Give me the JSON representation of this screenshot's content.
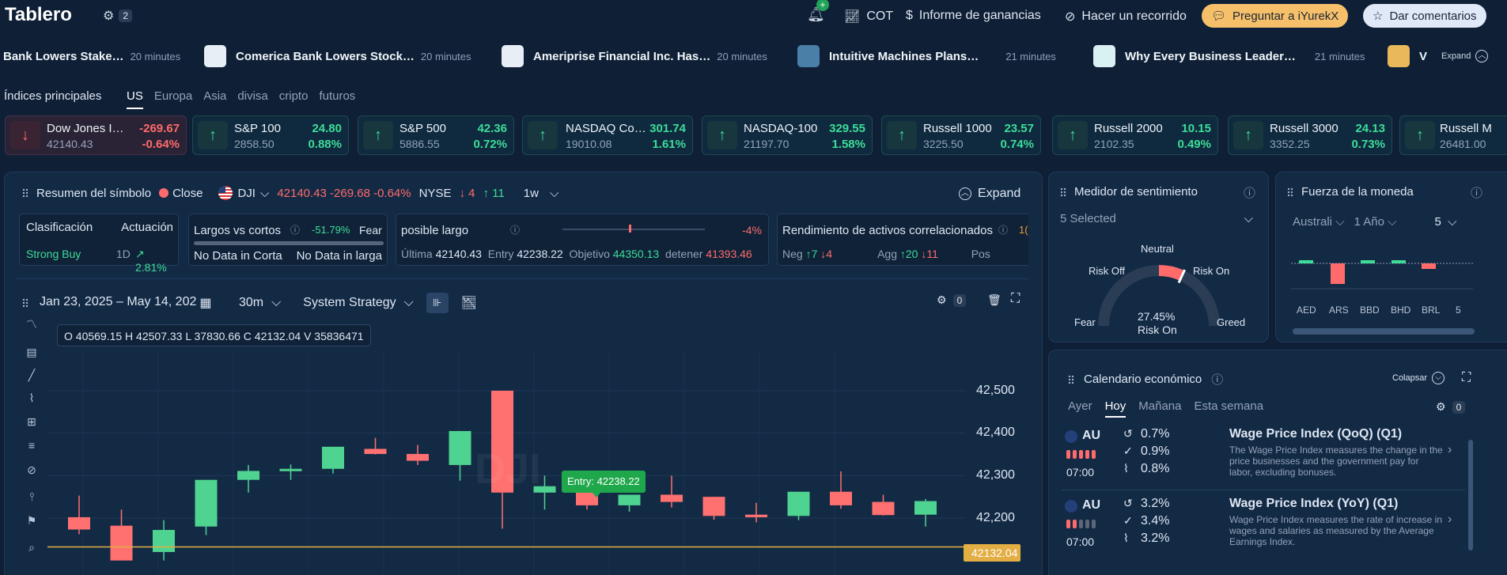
{
  "header": {
    "title": "Tablero",
    "filter_count": "2",
    "nav": [
      {
        "label": "COT",
        "icon": "chart-line-icon"
      },
      {
        "label": "Informe de ganancias",
        "icon": "dollar-icon"
      },
      {
        "label": "Hacer un recorrido",
        "icon": "compass-icon"
      }
    ],
    "ask_label": "Preguntar a iYurekX",
    "feedback_label": "Dar comentarios",
    "notification_badge": "+"
  },
  "news_ticker": {
    "items": [
      {
        "title": "Bank Lowers Stake…",
        "time": "20 minutes"
      },
      {
        "title": "Comerica Bank Lowers Stock…",
        "time": "20 minutes"
      },
      {
        "title": "Ameriprise Financial Inc. Has…",
        "time": "20 minutes"
      },
      {
        "title": "Intuitive Machines Plans…",
        "time": "21 minutes"
      },
      {
        "title": "Why Every Business Leader…",
        "time": "21 minutes"
      },
      {
        "title": "V",
        "time": ""
      }
    ],
    "expand_label": "Expand"
  },
  "indices": {
    "label": "Índices principales",
    "tabs": [
      "US",
      "Europa",
      "Asia",
      "divisa",
      "cripto",
      "futuros"
    ],
    "active_tab": "US",
    "cards": [
      {
        "name": "Dow Jones I…",
        "price": "42140.43",
        "change": "-269.67",
        "pct": "-0.64%",
        "dir": "down"
      },
      {
        "name": "S&P 100",
        "price": "2858.50",
        "change": "24.80",
        "pct": "0.88%",
        "dir": "up"
      },
      {
        "name": "S&P 500",
        "price": "5886.55",
        "change": "42.36",
        "pct": "0.72%",
        "dir": "up"
      },
      {
        "name": "NASDAQ Co…",
        "price": "19010.08",
        "change": "301.74",
        "pct": "1.61%",
        "dir": "up"
      },
      {
        "name": "NASDAQ-100",
        "price": "21197.70",
        "change": "329.55",
        "pct": "1.58%",
        "dir": "up"
      },
      {
        "name": "Russell 1000",
        "price": "3225.50",
        "change": "23.57",
        "pct": "0.74%",
        "dir": "up"
      },
      {
        "name": "Russell 2000",
        "price": "2102.35",
        "change": "10.15",
        "pct": "0.49%",
        "dir": "up"
      },
      {
        "name": "Russell 3000",
        "price": "3352.25",
        "change": "24.13",
        "pct": "0.73%",
        "dir": "up"
      },
      {
        "name": "Russell M",
        "price": "26481.00",
        "change": "",
        "pct": "",
        "dir": "up"
      }
    ]
  },
  "symbol": {
    "title": "Resumen del símbolo",
    "close_label": "Close",
    "ticker": "DJI",
    "price_line": "42140.43 -269.68 -0.64%",
    "exchange": "NYSE",
    "down_count": "4",
    "up_count": "11",
    "interval": "1w",
    "expand_label": "Expand",
    "classification": {
      "label": "Clasificación",
      "perf_label": "Actuación",
      "value": "Strong Buy",
      "period": "1D",
      "perf": "2.81%"
    },
    "long_short": {
      "label": "Largos vs cortos",
      "pct": "-51.79%",
      "mood": "Fear",
      "left": "No Data in Corta",
      "right": "No Data in larga"
    },
    "possible_long": {
      "label": "posible largo",
      "pct": "-4%",
      "ultima_label": "Última",
      "ultima": "42140.43",
      "entry_label": "Entry",
      "entry": "42238.22",
      "target_label": "Objetivo",
      "target": "44350.13",
      "stop_label": "detener",
      "stop": "41393.46"
    },
    "correlated": {
      "label": "Rendimiento de activos correlacionados",
      "neg_label": "Neg",
      "neg_up": "7",
      "neg_down": "4",
      "agg_label": "Agg",
      "agg_up": "20",
      "agg_down": "11",
      "pos_label": "Pos",
      "extra": "1("
    }
  },
  "chart_toolbar": {
    "date_range": "Jan 23, 2025 – May 14, 202",
    "timeframe": "30m",
    "strategy": "System Strategy",
    "indicator_count": "0"
  },
  "chart_data": {
    "type": "candlestick",
    "ohlcv_label": "O 40569.15 H 42507.33 L 37830.66 C 42132.04 V 35836471",
    "watermark": "DJI",
    "y_ticks": [
      "42,500",
      "42,400",
      "42,300",
      "42,200"
    ],
    "entry_label": "Entry: 42238.22",
    "last_price": "42132.04",
    "candles": [
      {
        "o": 42202,
        "h": 42253,
        "l": 42162,
        "c": 42173
      },
      {
        "o": 42182,
        "h": 42220,
        "l": 42110,
        "c": 42100
      },
      {
        "o": 42120,
        "h": 42195,
        "l": 42100,
        "c": 42172
      },
      {
        "o": 42180,
        "h": 42190,
        "l": 42160,
        "c": 42290
      },
      {
        "o": 42290,
        "h": 42325,
        "l": 42260,
        "c": 42311
      },
      {
        "o": 42311,
        "h": 42326,
        "l": 42290,
        "c": 42316
      },
      {
        "o": 42316,
        "h": 42354,
        "l": 42305,
        "c": 42368
      },
      {
        "o": 42363,
        "h": 42389,
        "l": 42350,
        "c": 42351
      },
      {
        "o": 42351,
        "h": 42372,
        "l": 42325,
        "c": 42335
      },
      {
        "o": 42325,
        "h": 42368,
        "l": 42288,
        "c": 42405
      },
      {
        "o": 42500,
        "h": 42500,
        "l": 42175,
        "c": 42260
      },
      {
        "o": 42260,
        "h": 42300,
        "l": 42220,
        "c": 42275
      },
      {
        "o": 42260,
        "h": 42280,
        "l": 42220,
        "c": 42230
      },
      {
        "o": 42230,
        "h": 42250,
        "l": 42215,
        "c": 42255
      },
      {
        "o": 42255,
        "h": 42300,
        "l": 42225,
        "c": 42238
      },
      {
        "o": 42250,
        "h": 42250,
        "l": 42196,
        "c": 42205
      },
      {
        "o": 42208,
        "h": 42236,
        "l": 42190,
        "c": 42202
      },
      {
        "o": 42205,
        "h": 42262,
        "l": 42195,
        "c": 42262
      },
      {
        "o": 42262,
        "h": 42310,
        "l": 42222,
        "c": 42230
      },
      {
        "o": 42238,
        "h": 42255,
        "l": 42206,
        "c": 42207
      },
      {
        "o": 42208,
        "h": 42245,
        "l": 42180,
        "c": 42240
      }
    ]
  },
  "sentiment": {
    "title": "Medidor de sentimiento",
    "selected": "5 Selected",
    "neutral": "Neutral",
    "risk_off": "Risk Off",
    "risk_on": "Risk On",
    "fear": "Fear",
    "greed": "Greed",
    "value": "27.45%",
    "value_label": "Risk On",
    "level": 0.6373
  },
  "currency": {
    "title": "Fuerza de la moneda",
    "region": "Australi",
    "period": "1 Año",
    "count": "5",
    "labels": [
      "AED",
      "ARS",
      "BBD",
      "BHD",
      "BRL",
      "5"
    ]
  },
  "calendar": {
    "title": "Calendario económico",
    "collapse_label": "Colapsar",
    "tabs": [
      "Ayer",
      "Hoy",
      "Mañana",
      "Esta semana"
    ],
    "active_tab": "Hoy",
    "filter_count": "0",
    "events": [
      {
        "country": "AU",
        "time": "07:00",
        "actual": "0.7%",
        "forecast": "0.9%",
        "previous": "0.8%",
        "title": "Wage Price Index (QoQ) (Q1)",
        "desc": "The Wage Price Index measures the change in the price businesses and the government pay for labor, excluding bonuses."
      },
      {
        "country": "AU",
        "time": "07:00",
        "actual": "3.2%",
        "forecast": "3.4%",
        "previous": "3.2%",
        "title": "Wage Price Index (YoY) (Q1)",
        "desc": "Wage Price Index measures the rate of increase in wages and salaries as measured by the Average Earnings Index."
      }
    ]
  }
}
